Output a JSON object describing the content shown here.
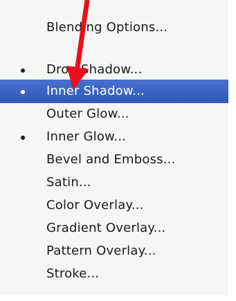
{
  "menu": {
    "items": [
      {
        "label": "Blending Options...",
        "bullet": false,
        "selected": false
      },
      {
        "label": "Drop Shadow...",
        "bullet": true,
        "selected": false
      },
      {
        "label": "Inner Shadow...",
        "bullet": true,
        "selected": true
      },
      {
        "label": "Outer Glow...",
        "bullet": false,
        "selected": false
      },
      {
        "label": "Inner Glow...",
        "bullet": true,
        "selected": false
      },
      {
        "label": "Bevel and Emboss...",
        "bullet": false,
        "selected": false
      },
      {
        "label": "Satin...",
        "bullet": false,
        "selected": false
      },
      {
        "label": "Color Overlay...",
        "bullet": false,
        "selected": false
      },
      {
        "label": "Gradient Overlay...",
        "bullet": false,
        "selected": false
      },
      {
        "label": "Pattern Overlay...",
        "bullet": false,
        "selected": false
      },
      {
        "label": "Stroke...",
        "bullet": false,
        "selected": false
      }
    ]
  },
  "colors": {
    "selection": "#3a62c4",
    "annotation_arrow": "#e8101a",
    "menu_background": "#f7f7f7"
  },
  "annotation": {
    "icon": "red-arrow-icon"
  }
}
